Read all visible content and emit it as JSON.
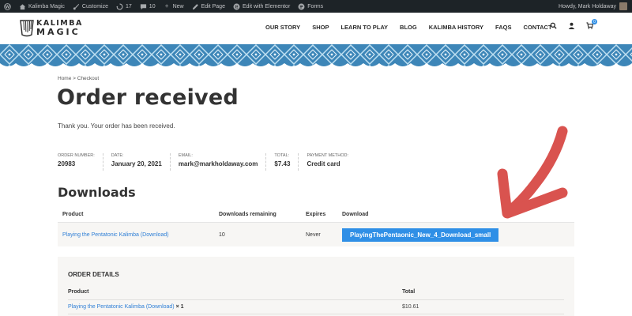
{
  "admin_bar": {
    "site_name": "Kalimba Magic",
    "customize": "Customize",
    "updates_count": "17",
    "comments_count": "10",
    "new_label": "New",
    "edit_page": "Edit Page",
    "edit_elementor": "Edit with Elementor",
    "forms": "Forms",
    "greeting": "Howdy, Mark Holdaway"
  },
  "header": {
    "logo_line1": "KALIMBA",
    "logo_line2": "MAGIC",
    "nav": [
      "OUR STORY",
      "SHOP",
      "LEARN TO PLAY",
      "BLOG",
      "KALIMBA HISTORY",
      "FAQS",
      "CONTACT"
    ],
    "cart_count": "0"
  },
  "breadcrumb": "Home > Checkout",
  "page_title": "Order received",
  "thanks": "Thank you. Your order has been received.",
  "overview": [
    {
      "label": "ORDER NUMBER:",
      "value": "20983"
    },
    {
      "label": "DATE:",
      "value": "January 20, 2021"
    },
    {
      "label": "EMAIL:",
      "value": "mark@markholdaway.com"
    },
    {
      "label": "TOTAL:",
      "value": "$7.43"
    },
    {
      "label": "PAYMENT METHOD:",
      "value": "Credit card"
    }
  ],
  "downloads": {
    "title": "Downloads",
    "headers": {
      "product": "Product",
      "remaining": "Downloads remaining",
      "expires": "Expires",
      "download": "Download"
    },
    "rows": [
      {
        "product": "Playing the Pentatonic Kalimba (Download)",
        "remaining": "10",
        "expires": "Never",
        "download": "PlayingThePentaonic_New_4_Download_small"
      }
    ]
  },
  "order_details": {
    "title": "ORDER DETAILS",
    "headers": {
      "product": "Product",
      "total": "Total"
    },
    "rows": [
      {
        "product": "Playing the Pentatonic Kalimba (Download)",
        "qty": "× 1",
        "total": "$10.61"
      }
    ]
  },
  "colors": {
    "accent_blue": "#2f8fe6",
    "annotation_red": "#d9534f",
    "admin_bar": "#1d2327",
    "pattern_blue": "#3d86b8"
  }
}
